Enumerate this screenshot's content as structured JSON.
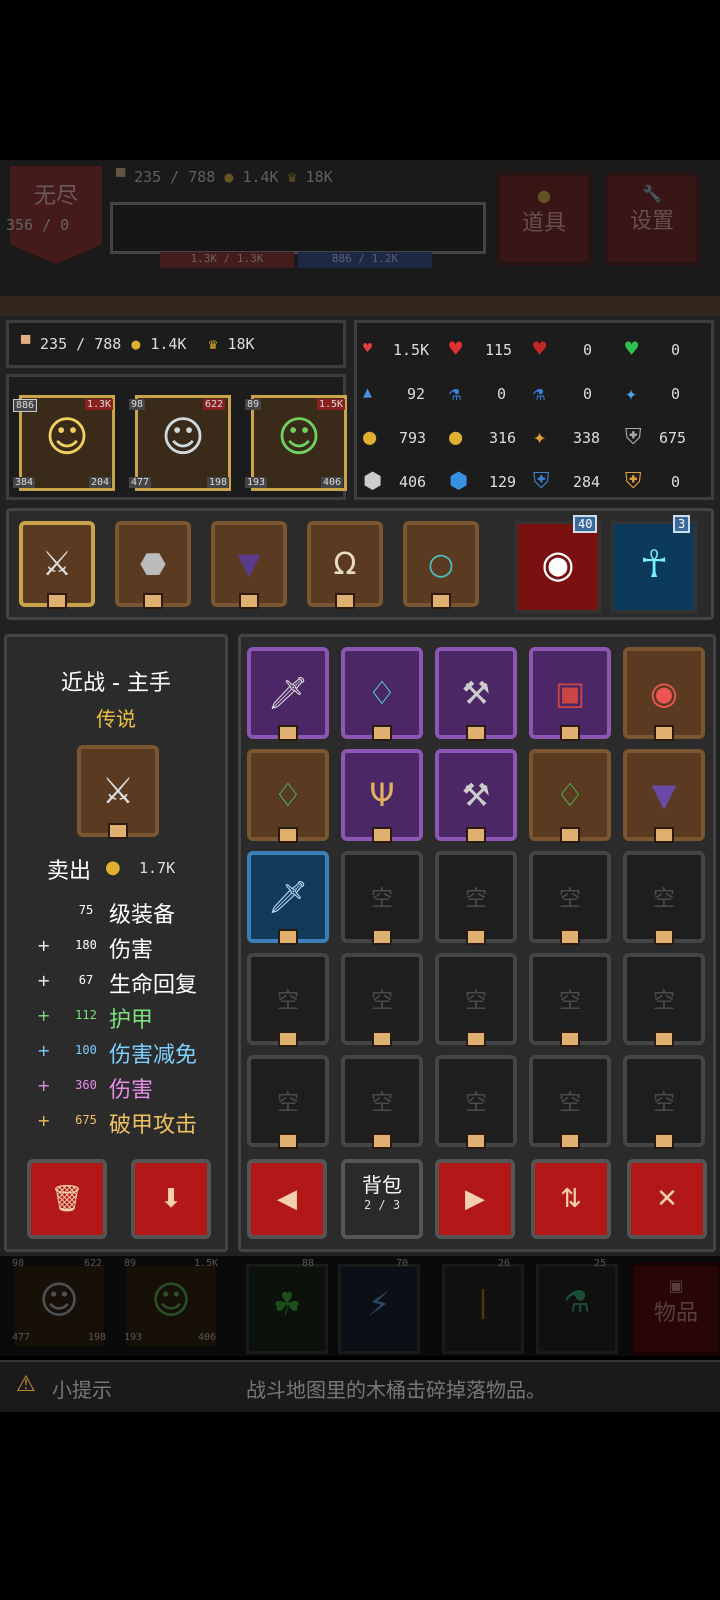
{
  "top": {
    "mode_label": "无尽",
    "wave": "356 / 0",
    "food": "235 / 788",
    "gold": "1.4K",
    "crown": "18K",
    "hp_bar": "1.3K / 1.3K",
    "mp_bar": "886 / 1.2K",
    "items_label": "道具",
    "settings_label": "设置"
  },
  "resources": {
    "food": "235 / 788",
    "gold": "1.4K",
    "crown": "18K"
  },
  "heroes": [
    {
      "level": "886",
      "hp": "1.3K",
      "atk": "384",
      "def": "204"
    },
    {
      "level": "98",
      "hp": "622",
      "atk": "477",
      "def": "198"
    },
    {
      "level": "89",
      "hp": "1.5K",
      "atk": "193",
      "def": "406"
    }
  ],
  "stats": [
    [
      "1.5K",
      "115",
      "0",
      "0"
    ],
    [
      "92",
      "0",
      "0",
      "0"
    ],
    [
      "793",
      "316",
      "338",
      "675"
    ],
    [
      "406",
      "129",
      "284",
      "0"
    ]
  ],
  "skills": {
    "eye_level": "40",
    "spirit_level": "3"
  },
  "detail": {
    "title": "近战 - 主手",
    "rarity": "传说",
    "sell_label": "卖出",
    "sell_price": "1.7K",
    "lines": [
      {
        "prefix": "",
        "value": "75",
        "label": "级装备",
        "color": "#ffffff"
      },
      {
        "prefix": "+",
        "value": "180",
        "label": "伤害",
        "color": "#ffffff"
      },
      {
        "prefix": "+",
        "value": "67",
        "label": "生命回复",
        "color": "#ffffff"
      },
      {
        "prefix": "+",
        "value": "112",
        "label": "护甲",
        "color": "#7ee07e"
      },
      {
        "prefix": "+",
        "value": "100",
        "label": "伤害减免",
        "color": "#7ecfff"
      },
      {
        "prefix": "+",
        "value": "360",
        "label": "伤害",
        "color": "#e78fe7"
      },
      {
        "prefix": "+",
        "value": "675",
        "label": "破甲攻击",
        "color": "#f0c060"
      }
    ]
  },
  "inventory": {
    "empty_label": "空",
    "backpack_label": "背包",
    "page": "2 / 3"
  },
  "bottom": {
    "hero2_level": "98",
    "hero2_hp": "622",
    "hero2_atk": "477",
    "hero2_def": "198",
    "hero3_level": "89",
    "hero3_hp": "1.5K",
    "hero3_atk": "193",
    "hero3_def": "406",
    "skill1": "88",
    "skill2": "70",
    "potion1": "26",
    "potion2": "25",
    "items_label": "物品"
  },
  "tip": {
    "label": "小提示",
    "text": "战斗地图里的木桶击碎掉落物品。"
  },
  "colors": {
    "legendary_gold": "#c9a44a",
    "epic_purple": "#8d56b3",
    "rare_blue": "#3d7fb8",
    "button_red": "#b31818"
  }
}
